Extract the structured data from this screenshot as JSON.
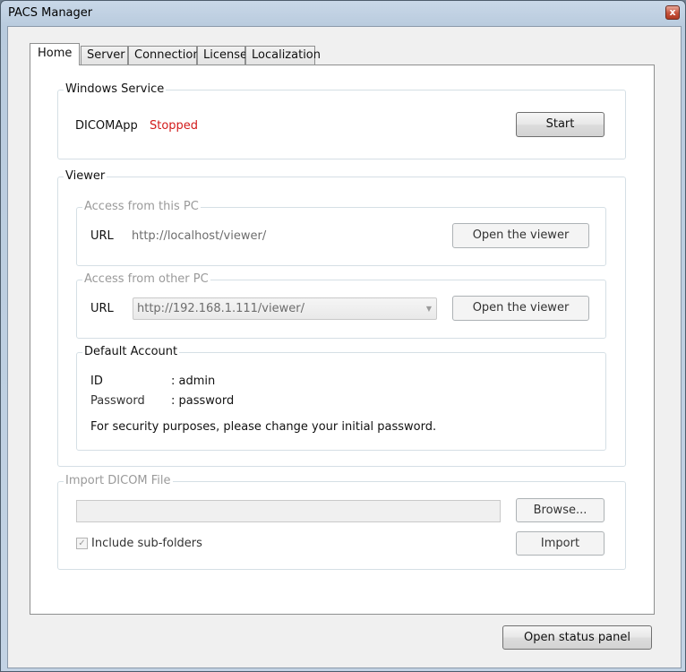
{
  "window": {
    "title": "PACS Manager",
    "close_glyph": "x"
  },
  "tabs": [
    {
      "label": "Home",
      "active": true
    },
    {
      "label": "Server",
      "active": false
    },
    {
      "label": "Connection",
      "active": false
    },
    {
      "label": "License",
      "active": false
    },
    {
      "label": "Localization",
      "active": false
    }
  ],
  "windows_service": {
    "legend": "Windows Service",
    "service_name": "DICOMApp",
    "status": "Stopped",
    "status_color": "#d21a1a",
    "start_label": "Start"
  },
  "viewer": {
    "legend": "Viewer",
    "local": {
      "legend": "Access from this PC",
      "url_label": "URL",
      "url_value": "http://localhost/viewer/",
      "open_label": "Open the viewer"
    },
    "remote": {
      "legend": "Access from other PC",
      "url_label": "URL",
      "url_value": "http://192.168.1.111/viewer/",
      "open_label": "Open the viewer"
    },
    "account": {
      "legend": "Default Account",
      "id_label": "ID",
      "id_value": ": admin",
      "password_label": "Password",
      "password_value": ": password",
      "note": "For security purposes, please change your initial password."
    }
  },
  "import": {
    "legend": "Import DICOM File",
    "path_value": "",
    "browse_label": "Browse...",
    "include_subfolders_label": "Include sub-folders",
    "include_subfolders_checked": true,
    "import_label": "Import"
  },
  "footer": {
    "status_panel_label": "Open status panel"
  }
}
